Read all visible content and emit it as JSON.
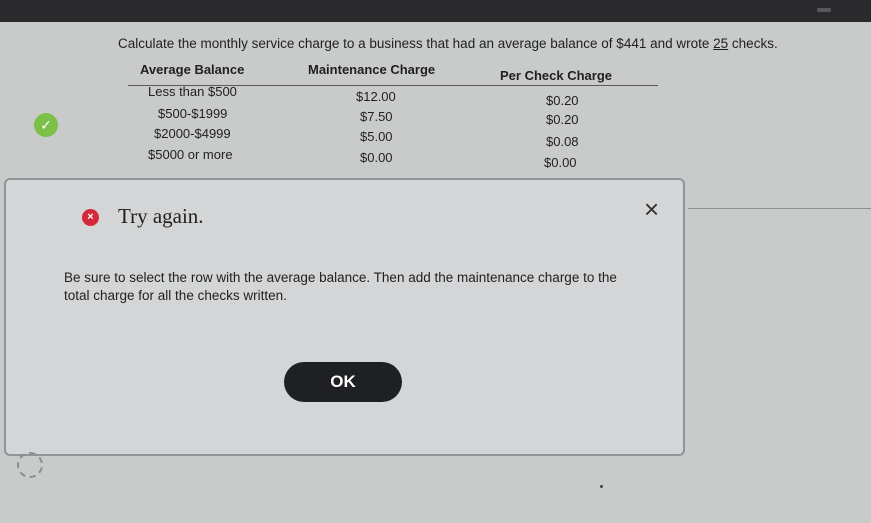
{
  "question": {
    "text_before": "Calculate the monthly service charge to a business that had an average balance of $441 and wrote ",
    "checks": "25",
    "text_after": " checks."
  },
  "table": {
    "headers": [
      "Average Balance",
      "Maintenance Charge",
      "Per Check Charge"
    ],
    "rows": [
      [
        "Less than $500",
        "$12.00",
        "$0.20"
      ],
      [
        "$500-$1999",
        "$7.50",
        "$0.20"
      ],
      [
        "$2000-$4999",
        "$5.00",
        "$0.08"
      ],
      [
        "$5000 or more",
        "$0.00",
        "$0.00"
      ]
    ]
  },
  "status_icon": {
    "name": "check-icon",
    "glyph": "✓",
    "color": "#7cc04a"
  },
  "dialog": {
    "icon": {
      "name": "error-x-icon",
      "glyph": "×",
      "color": "#d6283c"
    },
    "title": "Try again.",
    "close_glyph": "×",
    "body": "Be sure to select the row with the average balance. Then add the maintenance charge to the total charge for all the checks written.",
    "ok_label": "OK"
  }
}
